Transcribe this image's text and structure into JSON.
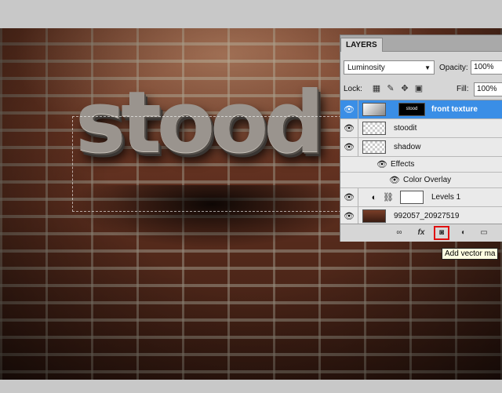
{
  "canvas": {
    "text": "stood"
  },
  "panel": {
    "tab_label": "LAYERS",
    "blend_mode": "Luminosity",
    "opacity_label": "Opacity:",
    "opacity_value": "100%",
    "lock_label": "Lock:",
    "fill_label": "Fill:",
    "fill_value": "100%",
    "layers": [
      {
        "name": "front texture",
        "selected": true
      },
      {
        "name": "stoodit"
      },
      {
        "name": "shadow"
      },
      {
        "name": "Effects"
      },
      {
        "name": "Color Overlay"
      },
      {
        "name": "Levels 1"
      },
      {
        "name": "992057_20927519"
      }
    ],
    "mask_thumb_text": "stood"
  },
  "tooltip": {
    "text": "Add vector ma"
  },
  "colors": {
    "selected_row": "#3a8ee6",
    "highlight": "#e01010"
  }
}
